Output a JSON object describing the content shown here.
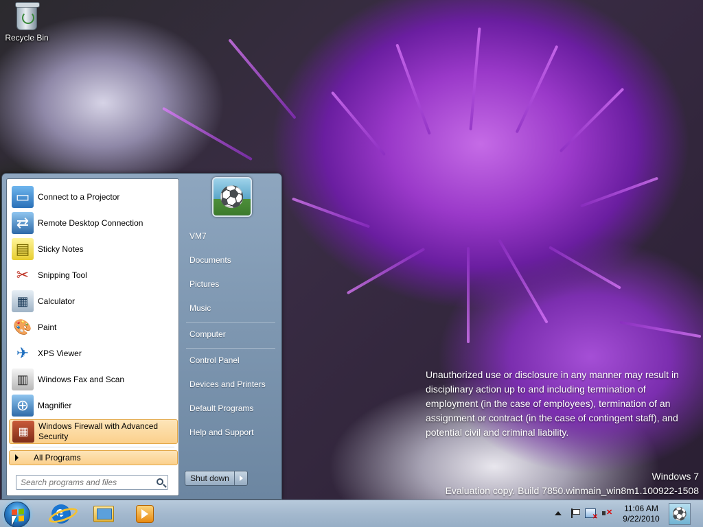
{
  "desktop": {
    "icons": [
      {
        "label": "Recycle Bin",
        "icon": "recycle-bin-icon"
      }
    ],
    "disclaimer": "Unauthorized use or disclosure in any manner may result in disciplinary action up to and including termination of employment (in the case of employees), termination of an assignment or contract (in the case of contingent staff), and potential civil and criminal liability.",
    "watermark": {
      "line1": "Windows 7",
      "line2": "Evaluation copy. Build 7850.winmain_win8m1.100922-1508"
    }
  },
  "start_menu": {
    "programs": [
      {
        "label": "Connect to a Projector",
        "icon": "monitor-projector-icon"
      },
      {
        "label": "Remote Desktop Connection",
        "icon": "remote-desktop-icon"
      },
      {
        "label": "Sticky Notes",
        "icon": "sticky-notes-icon"
      },
      {
        "label": "Snipping Tool",
        "icon": "scissors-icon"
      },
      {
        "label": "Calculator",
        "icon": "calculator-icon"
      },
      {
        "label": "Paint",
        "icon": "paint-palette-icon"
      },
      {
        "label": "XPS Viewer",
        "icon": "xps-viewer-icon"
      },
      {
        "label": "Windows Fax and Scan",
        "icon": "fax-icon"
      },
      {
        "label": "Magnifier",
        "icon": "magnifier-icon"
      },
      {
        "label": "Windows Firewall with Advanced Security",
        "icon": "firewall-icon",
        "highlighted": true
      }
    ],
    "all_programs": "All Programs",
    "search": {
      "placeholder": "Search programs and files",
      "value": ""
    },
    "right_links": [
      {
        "label": "VM7"
      },
      {
        "label": "Documents"
      },
      {
        "label": "Pictures"
      },
      {
        "label": "Music"
      },
      {
        "label": "Computer"
      },
      {
        "label": "Control Panel"
      },
      {
        "label": "Devices and Printers"
      },
      {
        "label": "Default Programs"
      },
      {
        "label": "Help and Support"
      }
    ],
    "user_picture": "soccer-ball-icon",
    "shutdown_label": "Shut down"
  },
  "taskbar": {
    "start_button": "windows-start-orb-icon",
    "pinned": [
      {
        "name": "Internet Explorer",
        "icon": "internet-explorer-icon"
      },
      {
        "name": "Windows Explorer",
        "icon": "folder-icon"
      },
      {
        "name": "Windows Media Player",
        "icon": "media-player-icon"
      }
    ],
    "tray": {
      "time": "11:06 AM",
      "date": "9/22/2010"
    }
  },
  "colors": {
    "highlight": "#fbd08c",
    "start_menu_right": "#6c86a1",
    "taskbar": "#a4b9ce"
  }
}
